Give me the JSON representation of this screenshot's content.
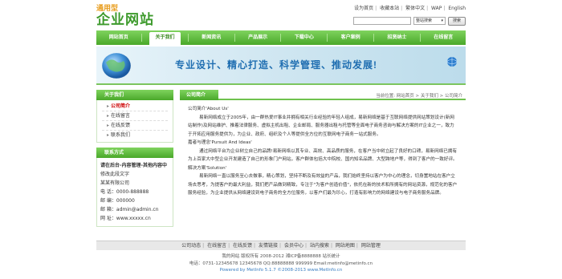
{
  "logo": {
    "line1": "通用型",
    "line2": "企业网站"
  },
  "toplinks": [
    "设为首页",
    "收藏本站",
    "繁体中文",
    "WAP",
    "English"
  ],
  "search": {
    "placeholder": "",
    "select_value": "整站搜索",
    "button": "搜索"
  },
  "nav": [
    "网站首页",
    "关于我们",
    "新闻资讯",
    "产品展示",
    "下载中心",
    "客户案例",
    "招贤纳士",
    "在线留言"
  ],
  "nav_active": 1,
  "banner": {
    "slogan": "专业设计、精心打造、科学管理、推动发展!"
  },
  "sidebar": {
    "title": "关于我们",
    "items": [
      "公司简介",
      "在线留言",
      "在线反馈",
      "联系我们"
    ],
    "current": 0
  },
  "contact": {
    "title": "联系方式",
    "rows": [
      "请在后台-内容管理-其他内容中",
      "修改此段文字",
      "某某有限公司",
      "电  话：0000-888888",
      "邮  编：000000",
      "邮  箱：admin@admin.cn",
      "网  址：www.xxxxx.cn"
    ]
  },
  "main": {
    "tab": "公司简介",
    "breadcrumb": "当前位置: 网站首页 > 关于我们 > 公司简介",
    "paragraphs": [
      {
        "cls": "h",
        "text": "公司简介'About Us'"
      },
      {
        "cls": "ind",
        "text": "易新网络成立于2005年，由一群热爱IT事业并拥有相关行业经验的年轻人组成，易新网络是基于互联网络提供网站策划设计(新网站制作)及网站维护、推着法律服务、虚拟主机出租、企业邮局、服务器出租与托管等全面电子商务咨询与解决方案的IT企业之一，致力于开拓应用服务提供为，为企业、政府、组织及个人等提供全方位的互联网电子商务一站式服务。"
      },
      {
        "cls": "h",
        "text": "嘉者与理念'Pursuit And Ideas'"
      },
      {
        "cls": "ind",
        "text": "通过网络平台为企业树立自己的品牌!易新网络以其专业、高效、高品质的服务，在客户当中树立起了良好的口碑，易新网络已拥有为上百家大中型企业开发建造了自己的形象门户网站，客户群体包括大中院校、国内知名品牌、大型跨地户等，得到了客户的一致好评。"
      },
      {
        "cls": "h",
        "text": "解决方案'Solution'"
      },
      {
        "cls": "ind",
        "text": "易新网络一直以服务至心去做事，精心策划，坚持不断及有效益的产品，我们始终坚持以客户为中心的理念，切身置地站在客户立场去思考，为提客户的最大利益，我们把产品做到精致，专注于\"为客户创造价值\"，依托在新的技术和所拥有的网站资源，规范化的客户服务经验，为企业提供从网络建设到电子商务的全方位服务，以客户们最为珍心，打造有影响力的网络建设与电子商务服务品牌。"
      }
    ]
  },
  "footer": {
    "links": [
      "公司动态",
      "在线留言",
      "在线反馈",
      "友情链接",
      "会员中心",
      "站内搜索",
      "网站地图",
      "网站管理"
    ],
    "info": [
      "我的网站 版权所有 2008-2012 湘ICP备8888888 站长统计",
      "电话：0731-12345678 12345678 QQ:88888888 999999 Email:metinfo@metinfo.cn",
      "Powered by MetInfo 5.1.7 ©2008-2013 www.MetInfo.cn"
    ]
  },
  "colors": {
    "nav_green": "#4aa82a",
    "logo_green": "#3d9a2c",
    "logo_orange": "#e89c1c",
    "slogan_blue": "#1f6eb1"
  }
}
